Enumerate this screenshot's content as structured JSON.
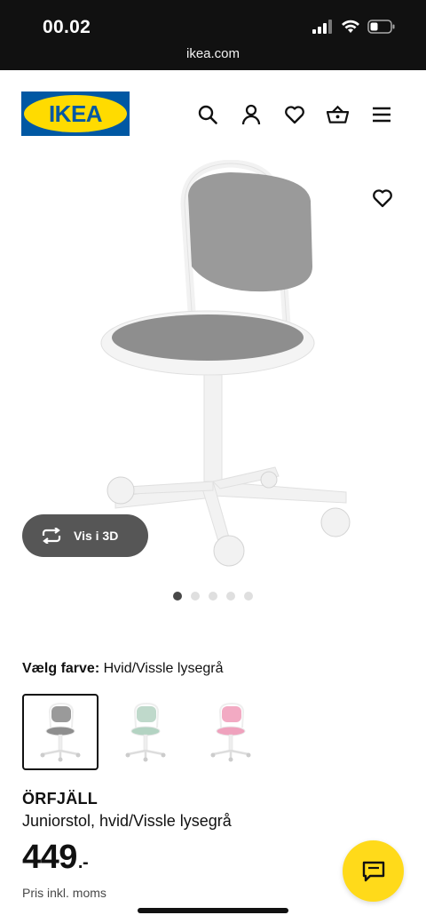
{
  "status_bar": {
    "time": "00.02",
    "url": "ikea.com"
  },
  "header": {
    "logo_text": "IKEA",
    "brand_blue": "#0058A3",
    "brand_yellow": "#FFDB00",
    "icons": [
      "search-icon",
      "account-icon",
      "favorites-icon",
      "cart-icon",
      "menu-icon"
    ]
  },
  "gallery": {
    "view_3d_label": "Vis i 3D",
    "image_count": 5,
    "active_image_index": 0
  },
  "color": {
    "label": "Vælg farve:",
    "value": "Hvid/Vissle lysegrå",
    "options": [
      "lysegrå",
      "grøn",
      "lyserød"
    ],
    "selected_index": 0
  },
  "product": {
    "name": "ÖRFJÄLL",
    "description": "Juniorstol, hvid/Vissle lysegrå",
    "price": "449",
    "price_suffix": ".-",
    "vat_note": "Pris inkl. moms"
  },
  "chat": {
    "accent": "#FFDA1A"
  }
}
